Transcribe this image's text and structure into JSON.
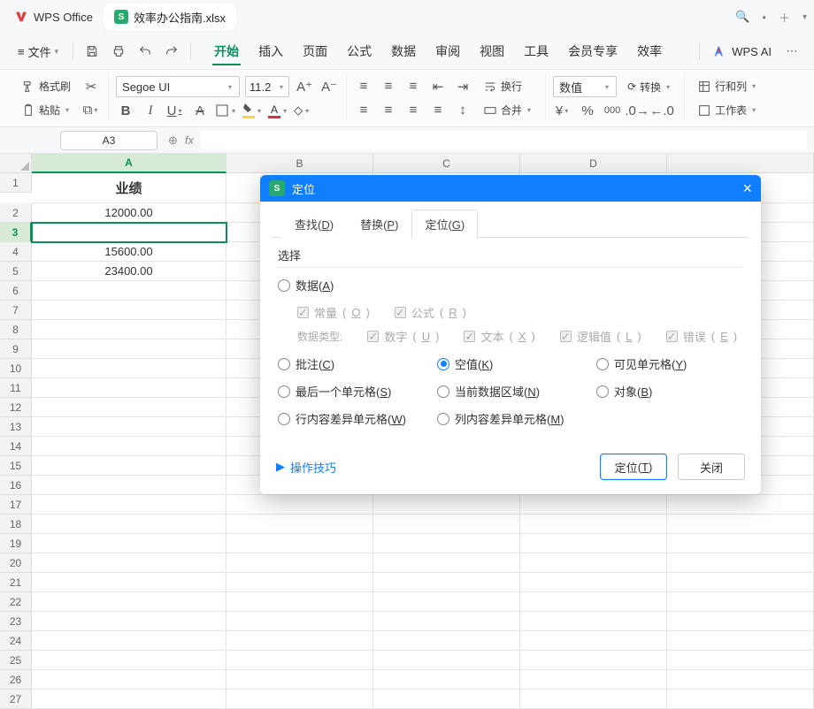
{
  "app": {
    "name": "WPS Office"
  },
  "tab": {
    "title": "效率办公指南.xlsx",
    "icon_letter": "S"
  },
  "titlebar_icons": {
    "mic": "⊕",
    "dot": "•",
    "plus": "＋"
  },
  "menu": {
    "file": "文件"
  },
  "ribbon_tabs": [
    "开始",
    "插入",
    "页面",
    "公式",
    "数据",
    "审阅",
    "视图",
    "工具",
    "会员专享",
    "效率"
  ],
  "ribbon_tabs_active_index": 0,
  "ai_button": "WPS AI",
  "tools": {
    "format_painter": "格式刷",
    "paste": "粘贴",
    "font_name": "Segoe UI",
    "font_size": "11.2",
    "wrap": "换行",
    "merge": "合并",
    "number_format": "数值",
    "convert": "转换",
    "row_col": "行和列",
    "worksheet": "工作表"
  },
  "namebox": "A3",
  "fx_label": "fx",
  "grid": {
    "cols": [
      "A",
      "B",
      "C",
      "D"
    ],
    "rows": 27,
    "selected_row": 3,
    "selected_col_index": 0,
    "header_cell": "业绩",
    "data": [
      "12000.00",
      "",
      "15600.00",
      "23400.00"
    ]
  },
  "dialog": {
    "title": "定位",
    "tabs": [
      {
        "label": "查找",
        "key": "D"
      },
      {
        "label": "替换",
        "key": "P"
      },
      {
        "label": "定位",
        "key": "G"
      }
    ],
    "active_tab": 2,
    "section_label": "选择",
    "opts": {
      "data": {
        "label": "数据",
        "key": "A"
      },
      "const": {
        "label": "常量",
        "key": "O"
      },
      "formula": {
        "label": "公式",
        "key": "R"
      },
      "dtype": "数据类型:",
      "num": {
        "label": "数字",
        "key": "U"
      },
      "txt": {
        "label": "文本",
        "key": "X"
      },
      "logic": {
        "label": "逻辑值",
        "key": "L"
      },
      "err": {
        "label": "错误",
        "key": "E"
      },
      "comment": {
        "label": "批注",
        "key": "C"
      },
      "blank": {
        "label": "空值",
        "key": "K"
      },
      "visible": {
        "label": "可见单元格",
        "key": "Y"
      },
      "last": {
        "label": "最后一个单元格",
        "key": "S"
      },
      "curregion": {
        "label": "当前数据区域",
        "key": "N"
      },
      "object": {
        "label": "对象",
        "key": "B"
      },
      "rowdiff": {
        "label": "行内容差异单元格",
        "key": "W"
      },
      "coldiff": {
        "label": "列内容差异单元格",
        "key": "M"
      }
    },
    "tip": "操作技巧",
    "go_btn": {
      "label": "定位",
      "key": "T"
    },
    "close_btn": "关闭"
  }
}
